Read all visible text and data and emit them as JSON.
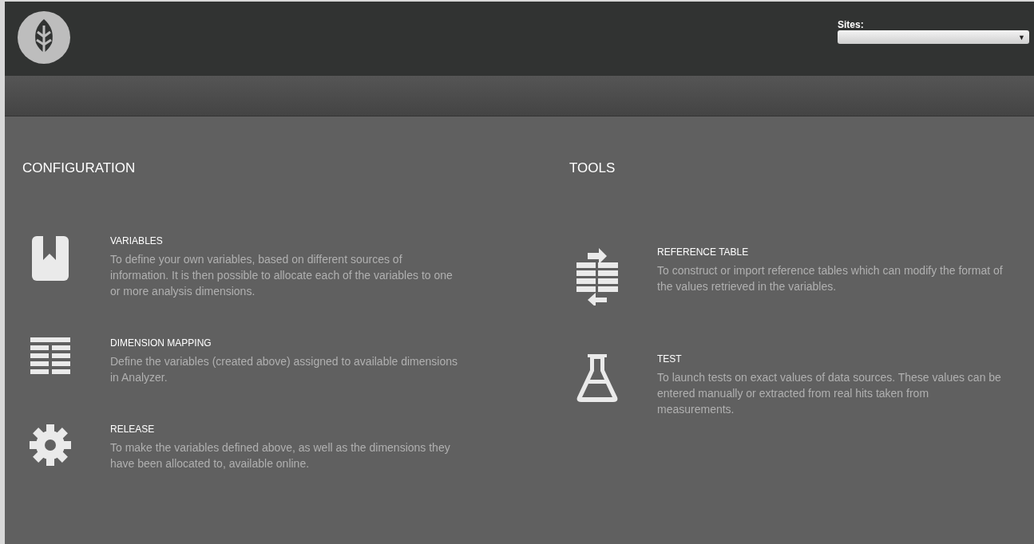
{
  "header": {
    "sites_label": "Sites:",
    "sites_caret": "▼"
  },
  "sections": [
    {
      "title": "CONFIGURATION",
      "items": [
        {
          "kind": "bookmark",
          "title": "VARIABLES",
          "description": "To define your own variables, based on different sources of information. It is then possible to allocate each of the variables to one or more analysis dimensions."
        },
        {
          "kind": "table",
          "title": "DIMENSION MAPPING",
          "description": "Define the variables (created above) assigned to available dimensions in Analyzer."
        },
        {
          "kind": "gear",
          "title": "RELEASE",
          "description": "To make the variables defined above, as well as the dimensions they have been allocated to, available online."
        }
      ]
    },
    {
      "title": "TOOLS",
      "items": [
        {
          "kind": "reference",
          "title": "REFERENCE TABLE",
          "description": "To construct or import reference tables which can modify the format of the values retrieved in the variables."
        },
        {
          "kind": "flask",
          "title": "TEST",
          "description": "To launch tests on exact values of data sources. These values can be entered manually or extracted from real hits taken from measurements."
        }
      ]
    }
  ]
}
